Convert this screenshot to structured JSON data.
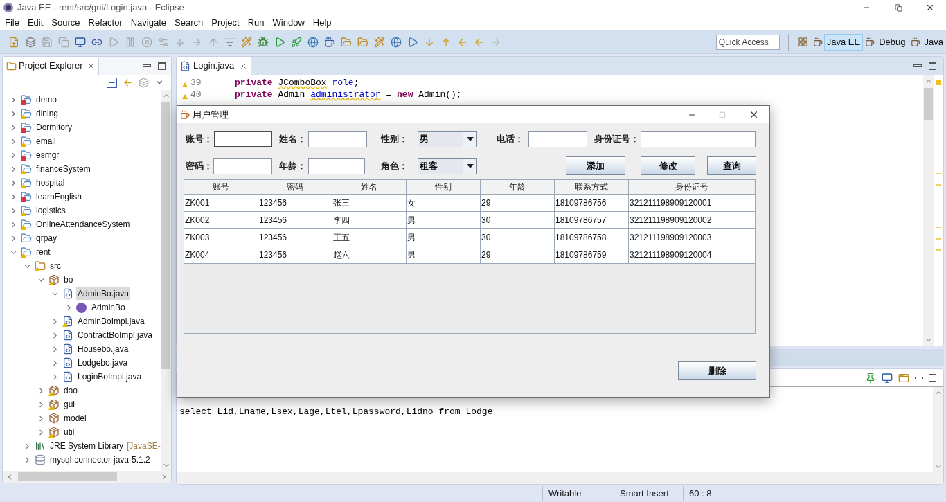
{
  "window": {
    "title": "Java EE - rent/src/gui/Login.java - Eclipse"
  },
  "menu": [
    "File",
    "Edit",
    "Source",
    "Refactor",
    "Navigate",
    "Search",
    "Project",
    "Run",
    "Window",
    "Help"
  ],
  "quick_access": {
    "placeholder": "Quick Access"
  },
  "perspectives": [
    {
      "label": "Java EE",
      "selected": true
    },
    {
      "label": "Debug",
      "selected": false
    },
    {
      "label": "Java",
      "selected": false
    }
  ],
  "project_explorer": {
    "title": "Project Explorer",
    "tree": [
      {
        "label": "demo",
        "kind": "project",
        "error": true,
        "warning": false,
        "expanded": false,
        "selected": false
      },
      {
        "label": "dining",
        "kind": "project",
        "error": false,
        "warning": true,
        "expanded": false,
        "selected": false
      },
      {
        "label": "Dormitory",
        "kind": "project",
        "error": true,
        "warning": false,
        "expanded": false,
        "selected": false
      },
      {
        "label": "email",
        "kind": "project",
        "error": false,
        "warning": true,
        "expanded": false,
        "selected": false
      },
      {
        "label": "esmgr",
        "kind": "project",
        "error": true,
        "warning": false,
        "expanded": false,
        "selected": false
      },
      {
        "label": "financeSystem",
        "kind": "project",
        "error": false,
        "warning": true,
        "expanded": false,
        "selected": false
      },
      {
        "label": "hospital",
        "kind": "project",
        "error": false,
        "warning": true,
        "expanded": false,
        "selected": false
      },
      {
        "label": "learnEnglish",
        "kind": "project",
        "error": true,
        "warning": false,
        "expanded": false,
        "selected": false
      },
      {
        "label": "logistics",
        "kind": "project",
        "error": false,
        "warning": true,
        "expanded": false,
        "selected": false
      },
      {
        "label": "OnlineAttendanceSystem",
        "kind": "project",
        "error": false,
        "warning": true,
        "expanded": false,
        "selected": false
      },
      {
        "label": "qrpay",
        "kind": "project",
        "error": false,
        "warning": false,
        "expanded": false,
        "selected": false
      },
      {
        "label": "rent",
        "kind": "project",
        "error": false,
        "warning": true,
        "expanded": true,
        "selected": false,
        "children": [
          {
            "label": "src",
            "kind": "source",
            "error": false,
            "warning": true,
            "expanded": true,
            "selected": false,
            "children": [
              {
                "label": "bo",
                "kind": "package",
                "error": false,
                "warning": true,
                "expanded": true,
                "selected": false,
                "children": [
                  {
                    "label": "AdminBo.java",
                    "kind": "file",
                    "error": false,
                    "warning": false,
                    "expanded": true,
                    "selected": true,
                    "children": [
                      {
                        "label": "AdminBo",
                        "kind": "interface",
                        "error": false,
                        "warning": false,
                        "expanded": false,
                        "selected": false
                      }
                    ]
                  },
                  {
                    "label": "AdminBoImpl.java",
                    "kind": "file",
                    "error": false,
                    "warning": true,
                    "expanded": false,
                    "selected": false
                  },
                  {
                    "label": "ContractBoImpl.java",
                    "kind": "file",
                    "error": false,
                    "warning": false,
                    "expanded": false,
                    "selected": false
                  },
                  {
                    "label": "Housebo.java",
                    "kind": "file",
                    "error": false,
                    "warning": false,
                    "expanded": false,
                    "selected": false
                  },
                  {
                    "label": "Lodgebo.java",
                    "kind": "file",
                    "error": false,
                    "warning": false,
                    "expanded": false,
                    "selected": false
                  },
                  {
                    "label": "LoginBoImpl.java",
                    "kind": "file",
                    "error": false,
                    "warning": false,
                    "expanded": false,
                    "selected": false
                  }
                ]
              },
              {
                "label": "dao",
                "kind": "package",
                "error": false,
                "warning": true,
                "expanded": false,
                "selected": false
              },
              {
                "label": "gui",
                "kind": "package",
                "error": false,
                "warning": true,
                "expanded": false,
                "selected": false
              },
              {
                "label": "model",
                "kind": "package",
                "error": false,
                "warning": false,
                "expanded": false,
                "selected": false
              },
              {
                "label": "util",
                "kind": "package",
                "error": false,
                "warning": true,
                "expanded": false,
                "selected": false
              }
            ]
          },
          {
            "label": "JRE System Library",
            "decoration": "[JavaSE-",
            "kind": "library",
            "error": false,
            "warning": false,
            "expanded": false,
            "selected": false
          },
          {
            "label": "mysql-connector-java-5.1.2",
            "kind": "jar",
            "error": false,
            "warning": false,
            "expanded": false,
            "selected": false
          }
        ]
      }
    ]
  },
  "editor": {
    "tab": "Login.java",
    "lines": [
      {
        "number": "39",
        "warning": true,
        "tokens": [
          {
            "text": "private",
            "kind": "keyword",
            "squiggle": false
          },
          {
            "text": "JComboBox",
            "kind": "plain",
            "squiggle": true
          },
          {
            "text": "role",
            "kind": "field",
            "squiggle": false
          },
          {
            "text": ";",
            "kind": "plain",
            "squiggle": false,
            "joined": true
          }
        ]
      },
      {
        "number": "40",
        "warning": true,
        "tokens": [
          {
            "text": "private",
            "kind": "keyword",
            "squiggle": false
          },
          {
            "text": "Admin",
            "kind": "plain",
            "squiggle": false
          },
          {
            "text": "administrator",
            "kind": "field",
            "squiggle": true
          },
          {
            "text": "=",
            "kind": "plain",
            "squiggle": false
          },
          {
            "text": "new",
            "kind": "keyword",
            "squiggle": false
          },
          {
            "text": "Admin();",
            "kind": "plain",
            "squiggle": false
          }
        ]
      }
    ]
  },
  "console": {
    "text": "select Lid,Lname,Lsex,Lage,Ltel,Lpassword,Lidno from Lodge"
  },
  "status_bar": [
    "Writable",
    "Smart Insert",
    "60 : 8"
  ],
  "dialog": {
    "title": "用户管理",
    "row_1": [
      {
        "kind": "text",
        "label": "账号：",
        "focused": true
      },
      {
        "kind": "text",
        "label": "姓名：",
        "focused": false
      },
      {
        "kind": "combo",
        "label": "性别：",
        "value": "男"
      },
      {
        "kind": "text",
        "label": "电话：",
        "focused": false
      },
      {
        "kind": "text",
        "label": "身份证号：",
        "focused": false
      }
    ],
    "row_2": [
      {
        "kind": "text",
        "label": "密码：",
        "focused": false
      },
      {
        "kind": "text",
        "label": "年龄：",
        "focused": false
      },
      {
        "kind": "combo",
        "label": "角色：",
        "value": "租客"
      }
    ],
    "actions": [
      "添加",
      "修改",
      "查询"
    ],
    "table": {
      "columns": [
        "账号",
        "密码",
        "姓名",
        "性别",
        "年龄",
        "联系方式",
        "身份证号"
      ],
      "rows": [
        [
          "ZK001",
          "123456",
          "张三",
          "女",
          "29",
          "18109786756",
          "321211198909120001"
        ],
        [
          "ZK002",
          "123456",
          "李四",
          "男",
          "30",
          "18109786757",
          "321211198909120002"
        ],
        [
          "ZK003",
          "123456",
          "王五",
          "男",
          "30",
          "18109786758",
          "321211198909120003"
        ],
        [
          "ZK004",
          "123456",
          "赵六",
          "男",
          "29",
          "18109786759",
          "321211198909120004"
        ]
      ]
    },
    "delete_button": "删除"
  }
}
